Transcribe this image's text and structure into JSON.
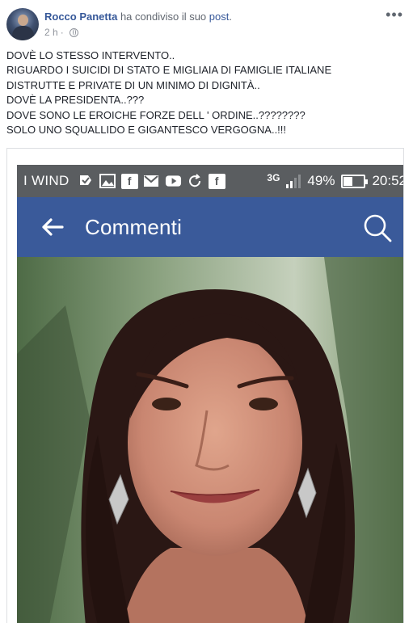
{
  "post": {
    "author": "Rocco Panetta",
    "shared_text": "ha condiviso il suo",
    "post_link": "post",
    "period": ".",
    "time": "2 h",
    "dot": "·",
    "more": "•••",
    "text_lines": [
      "DOVÈ LO STESSO INTERVENTO..",
      "RIGUARDO I SUICIDI DI STATO E MIGLIAIA DI FAMIGLIE ITALIANE",
      "DISTRUTTE E PRIVATE DI UN MINIMO DI DIGNITÀ..",
      "DOVÈ LA PRESIDENTA..???",
      "DOVE SONO LE EROICHE FORZE DELL ' ORDINE..????????",
      "SOLO UNO SQUALLIDO E GIGANTESCO VERGOGNA..!!!"
    ]
  },
  "screenshot": {
    "status_bar": {
      "carrier": "I WIND",
      "network": "3G",
      "battery": "49%",
      "time": "20:52",
      "notification_icons": [
        "check-flag-icon",
        "image-icon",
        "facebook-icon",
        "gmail-icon",
        "youtube-icon",
        "sync-icon",
        "facebook-icon"
      ]
    },
    "app_bar": {
      "title": "Commenti",
      "color": "#3a5a9a"
    }
  },
  "colors": {
    "link": "#365899",
    "meta": "#90949c",
    "text": "#1d2129",
    "status_bar": "#5a5d60"
  }
}
